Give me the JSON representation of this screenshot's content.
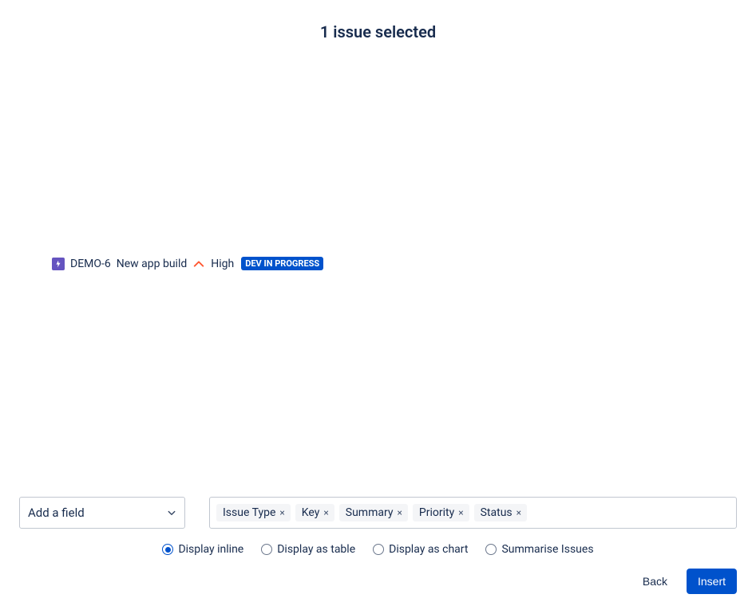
{
  "header": {
    "title": "1 issue selected"
  },
  "issue": {
    "key": "DEMO-6",
    "summary": "New app build",
    "priority": "High",
    "status": "DEV IN PROGRESS"
  },
  "addField": {
    "placeholder": "Add a field"
  },
  "tags": [
    {
      "label": "Issue Type"
    },
    {
      "label": "Key"
    },
    {
      "label": "Summary"
    },
    {
      "label": "Priority"
    },
    {
      "label": "Status"
    }
  ],
  "displayOptions": [
    {
      "label": "Display inline",
      "selected": true
    },
    {
      "label": "Display as table",
      "selected": false
    },
    {
      "label": "Display as chart",
      "selected": false
    },
    {
      "label": "Summarise Issues",
      "selected": false
    }
  ],
  "footer": {
    "back": "Back",
    "insert": "Insert"
  }
}
